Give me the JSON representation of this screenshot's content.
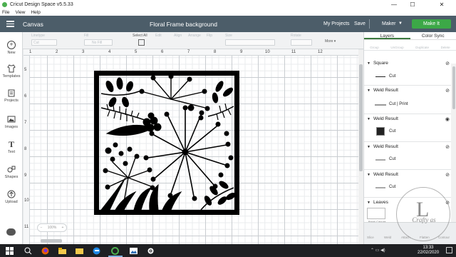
{
  "window": {
    "title": "Cricut Design Space  v5.5.33",
    "minimize": "—",
    "maximize": "☐",
    "close": "✕"
  },
  "menu": [
    "File",
    "View",
    "Help"
  ],
  "header": {
    "section": "Canvas",
    "doc_title": "Floral Frame background",
    "my_projects": "My Projects",
    "save": "Save",
    "machine": "Maker",
    "make_it": "Make It"
  },
  "toolbar": {
    "linetype": "Linetype",
    "linetype_val": "Cut",
    "fill": "Fill",
    "fill_val": "No Fill",
    "select_all": "Select All",
    "edit": "Edit",
    "align": "Align",
    "arrange": "Arrange",
    "flip": "Flip",
    "size": "Size",
    "rotate": "Rotate",
    "more": "More"
  },
  "ruler": {
    "top": [
      "1",
      "2",
      "3",
      "4",
      "5",
      "6",
      "7",
      "8",
      "9",
      "10",
      "11",
      "12"
    ],
    "left": [
      "5",
      "6",
      "7",
      "8",
      "9",
      "10",
      "11"
    ]
  },
  "sidebar": [
    {
      "label": "New",
      "icon": "plus-icon"
    },
    {
      "label": "Templates",
      "icon": "shirt-icon"
    },
    {
      "label": "Projects",
      "icon": "projects-icon"
    },
    {
      "label": "Images",
      "icon": "image-icon"
    },
    {
      "label": "Text",
      "icon": "text-icon"
    },
    {
      "label": "Shapes",
      "icon": "shapes-icon"
    },
    {
      "label": "Upload",
      "icon": "upload-icon"
    }
  ],
  "panel": {
    "tabs": [
      "Layers",
      "Color Sync"
    ],
    "actions": [
      "Group",
      "UnGroup",
      "Duplicate",
      "Delete"
    ],
    "layers": [
      {
        "name": "Square",
        "op": "Cut"
      },
      {
        "name": "Weld Result",
        "op": "Cut  |  Print"
      },
      {
        "name": "Weld Result",
        "op": "Cut"
      },
      {
        "name": "Weld Result",
        "op": "Cut"
      },
      {
        "name": "Weld Result",
        "op": "Cut"
      },
      {
        "name": "Leaves",
        "op": "Blank Canvas"
      }
    ],
    "footer": [
      "Slice",
      "Weld",
      "Attach",
      "Flatten",
      "Contour"
    ]
  },
  "canvas": {
    "zoom_label": "100%"
  },
  "watermark": {
    "letter": "L",
    "text": "Crafty as"
  },
  "taskbar": {
    "time": "13:33",
    "date": "22/02/2020"
  },
  "colors": {
    "header": "#4c5d69",
    "make_it": "#3ca847",
    "artwork": "#000000"
  }
}
